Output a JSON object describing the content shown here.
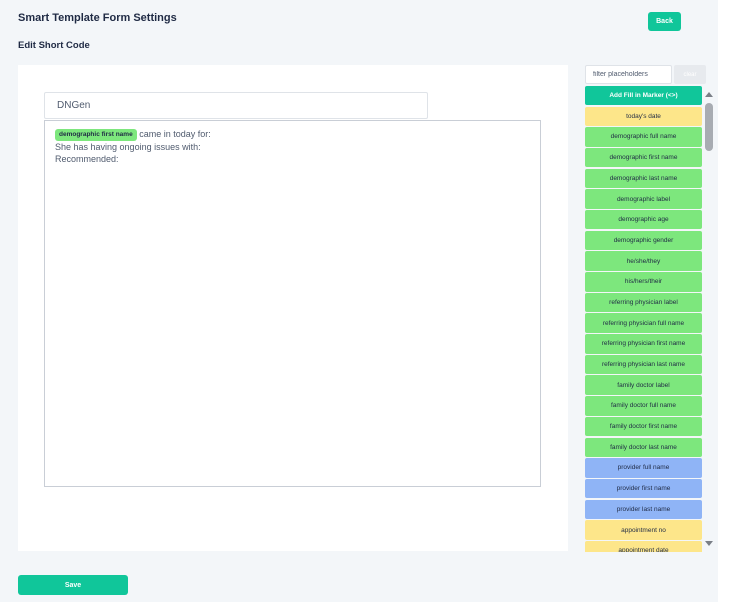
{
  "header": {
    "title": "Smart Template Form Settings",
    "subtitle": "Edit Short Code",
    "back_label": "Back"
  },
  "editor": {
    "name_value": "DNGen",
    "chip_label": "demographic first name",
    "line1_rest": " came in today for:",
    "line2": "She has having ongoing issues with:",
    "line3": "Recommended:"
  },
  "footer": {
    "save_label": "Save"
  },
  "placeholders": {
    "filter_placeholder": "filter placeholders",
    "clear_label": "clear",
    "add_label": "Add Fill in Marker (<>)",
    "items": [
      {
        "label": "today's date",
        "color": "#fde68a"
      },
      {
        "label": "demographic full name",
        "color": "#7de77d"
      },
      {
        "label": "demographic first name",
        "color": "#7de77d"
      },
      {
        "label": "demographic last name",
        "color": "#7de77d"
      },
      {
        "label": "demographic label",
        "color": "#7de77d"
      },
      {
        "label": "demographic age",
        "color": "#7de77d"
      },
      {
        "label": "demographic gender",
        "color": "#7de77d"
      },
      {
        "label": "he/she/they",
        "color": "#7de77d"
      },
      {
        "label": "his/hers/their",
        "color": "#7de77d"
      },
      {
        "label": "referring physician label",
        "color": "#7de77d"
      },
      {
        "label": "referring physician full name",
        "color": "#7de77d"
      },
      {
        "label": "referring physician first name",
        "color": "#7de77d"
      },
      {
        "label": "referring physician last name",
        "color": "#7de77d"
      },
      {
        "label": "family doctor label",
        "color": "#7de77d"
      },
      {
        "label": "family doctor full name",
        "color": "#7de77d"
      },
      {
        "label": "family doctor first name",
        "color": "#7de77d"
      },
      {
        "label": "family doctor last name",
        "color": "#7de77d"
      },
      {
        "label": "provider full name",
        "color": "#8fb4f6"
      },
      {
        "label": "provider first name",
        "color": "#8fb4f6"
      },
      {
        "label": "provider last name",
        "color": "#8fb4f6"
      },
      {
        "label": "appointment no",
        "color": "#fde68a"
      },
      {
        "label": "appointment date",
        "color": "#fde68a"
      }
    ]
  },
  "colors": {
    "accent": "#10c69a",
    "background": "#f3f6f9",
    "text": "#1f2a44"
  }
}
